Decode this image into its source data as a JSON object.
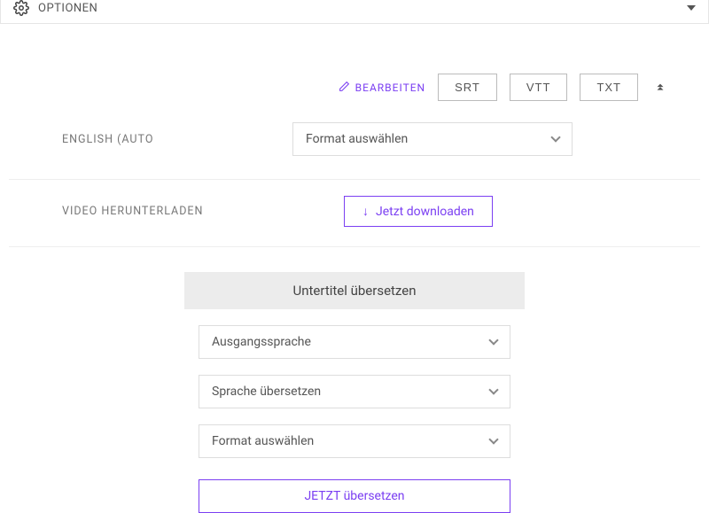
{
  "options": {
    "label": "OPTIONEN"
  },
  "edit": {
    "label": "BEARBEITEN"
  },
  "formats": {
    "srt": "SRT",
    "vtt": "VTT",
    "txt": "TXT"
  },
  "lang": {
    "label": "ENGLISH (AUTO",
    "select": "Format auswählen"
  },
  "download": {
    "label": "VIDEO HERUNTERLADEN",
    "button": "Jetzt downloaden"
  },
  "translate": {
    "header": "Untertitel übersetzen",
    "source": "Ausgangssprache",
    "target": "Sprache übersetzen",
    "format": "Format auswählen",
    "action": "JETZT übersetzen"
  }
}
